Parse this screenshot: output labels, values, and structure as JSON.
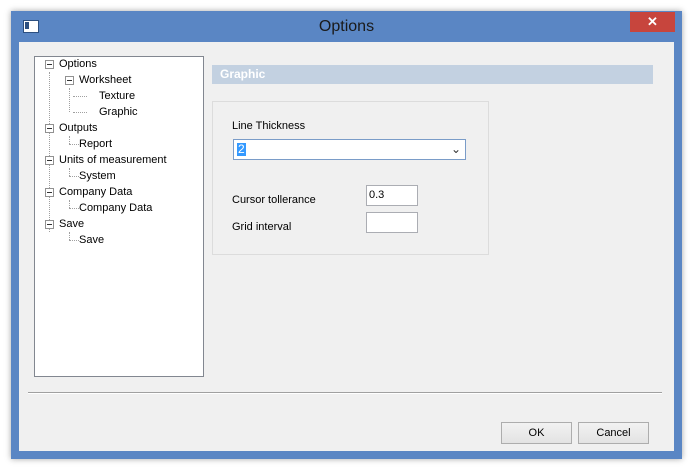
{
  "window": {
    "title": "Options",
    "close_glyph": "✕"
  },
  "tree": {
    "items": [
      {
        "label": "Options"
      },
      {
        "label": "Worksheet"
      },
      {
        "label": "Texture"
      },
      {
        "label": "Graphic"
      },
      {
        "label": "Outputs"
      },
      {
        "label": "Report"
      },
      {
        "label": "Units of measurement"
      },
      {
        "label": "System"
      },
      {
        "label": "Company Data"
      },
      {
        "label": "Company Data"
      },
      {
        "label": "Save"
      },
      {
        "label": "Save"
      }
    ]
  },
  "panel": {
    "header": "Graphic",
    "line_thickness_label": "Line Thickness",
    "line_thickness_value": "2",
    "cursor_tolerance_label": "Cursor tollerance",
    "cursor_tolerance_value": "0.3",
    "grid_interval_label": "Grid interval",
    "grid_interval_value": ""
  },
  "buttons": {
    "ok": "OK",
    "cancel": "Cancel"
  },
  "colors": {
    "title_bar": "#5a86c4",
    "close_button": "#c7453d",
    "selection": "#3399ff"
  }
}
